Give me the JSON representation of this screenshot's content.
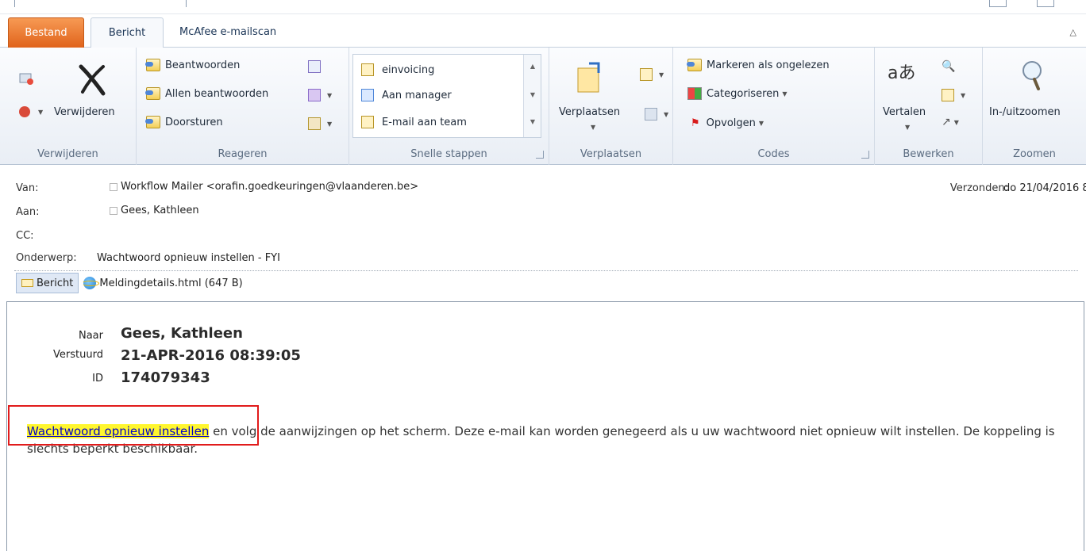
{
  "tabs": {
    "file": "Bestand",
    "active": "Bericht",
    "mcafee": "McAfee e-mailscan"
  },
  "ribbon": {
    "delete_group": {
      "label": "Verwijderen",
      "delete_button": "Verwijderen"
    },
    "respond_group": {
      "label": "Reageren",
      "reply": "Beantwoorden",
      "reply_all": "Allen beantwoorden",
      "forward": "Doorsturen"
    },
    "quick_steps": {
      "label": "Snelle stappen",
      "items": [
        "einvoicing",
        "Aan manager",
        "E-mail aan team"
      ]
    },
    "move_group": {
      "label": "Verplaatsen",
      "move_button": "Verplaatsen"
    },
    "tags_group": {
      "label": "Codes",
      "mark_unread": "Markeren als ongelezen",
      "categorize": "Categoriseren",
      "follow_up": "Opvolgen"
    },
    "edit_group": {
      "label": "Bewerken",
      "translate": "Vertalen"
    },
    "zoom_group": {
      "label": "Zoomen",
      "zoom_button": "In-/uitzoomen"
    }
  },
  "header": {
    "from_label": "Van:",
    "from_value": "Workflow Mailer <orafin.goedkeuringen@vlaanderen.be>",
    "to_label": "Aan:",
    "to_value": "Gees, Kathleen",
    "cc_label": "CC:",
    "subject_label": "Onderwerp:",
    "subject_value": "Wachtwoord opnieuw instellen - FYI",
    "sent_label": "Verzonden:",
    "sent_value": "do 21/04/2016 8"
  },
  "attachments": {
    "message_tab": "Bericht",
    "file": "Meldingdetails.html (647 B)"
  },
  "message": {
    "to_label": "Naar",
    "to_value": "Gees, Kathleen",
    "sent_label": "Verstuurd",
    "sent_value": "21-APR-2016 08:39:05",
    "id_label": "ID",
    "id_value": "174079343",
    "link_text": "Wachtwoord opnieuw instellen",
    "body_text": " en volg de aanwijzingen op het scherm. Deze e-mail kan worden genegeerd als u uw wachtwoord niet opnieuw wilt instellen. De koppeling is slechts beperkt beschikbaar."
  },
  "colors": {
    "file_tab": "#e0631b",
    "highlight": "#fff62e",
    "annotation_box": "#e11b1b",
    "link": "#0000c8"
  }
}
